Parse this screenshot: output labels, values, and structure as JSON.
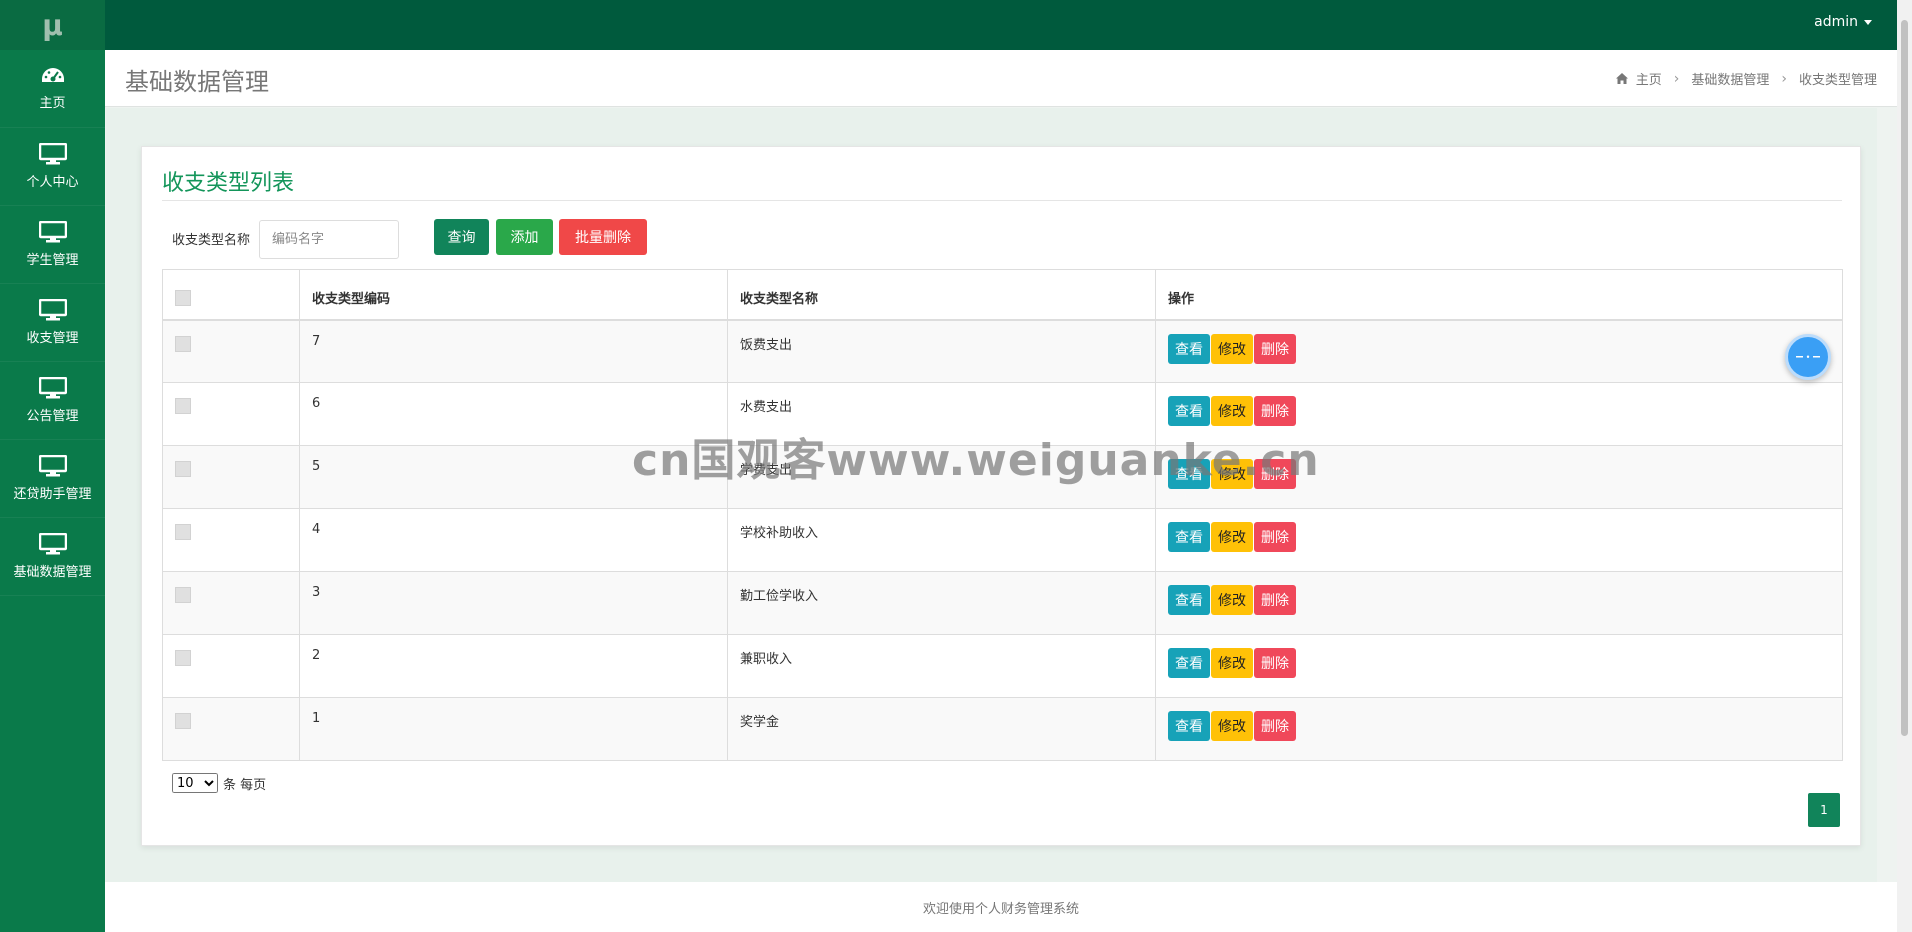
{
  "app": {
    "logo": "μ"
  },
  "topbar": {
    "user": "admin"
  },
  "sidebar": {
    "items": [
      {
        "label": "主页",
        "icon": "dashboard-icon"
      },
      {
        "label": "个人中心",
        "icon": "monitor-icon"
      },
      {
        "label": "学生管理",
        "icon": "monitor-icon"
      },
      {
        "label": "收支管理",
        "icon": "monitor-icon"
      },
      {
        "label": "公告管理",
        "icon": "monitor-icon"
      },
      {
        "label": "还贷助手管理",
        "icon": "monitor-icon"
      },
      {
        "label": "基础数据管理",
        "icon": "monitor-icon"
      }
    ]
  },
  "page": {
    "title": "基础数据管理",
    "breadcrumb": {
      "home": "主页",
      "section": "基础数据管理",
      "current": "收支类型管理"
    }
  },
  "card": {
    "title": "收支类型列表",
    "search": {
      "label": "收支类型名称",
      "placeholder": "编码名字"
    },
    "buttons": {
      "query": "查询",
      "add": "添加",
      "batch_delete": "批量删除"
    }
  },
  "table": {
    "headers": {
      "code": "收支类型编码",
      "name": "收支类型名称",
      "ops": "操作"
    },
    "op_labels": {
      "view": "查看",
      "edit": "修改",
      "delete": "删除"
    },
    "rows": [
      {
        "code": "7",
        "name": "饭费支出"
      },
      {
        "code": "6",
        "name": "水费支出"
      },
      {
        "code": "5",
        "name": "学费支出"
      },
      {
        "code": "4",
        "name": "学校补助收入"
      },
      {
        "code": "3",
        "name": "勤工俭学收入"
      },
      {
        "code": "2",
        "name": "兼职收入"
      },
      {
        "code": "1",
        "name": "奖学金"
      }
    ]
  },
  "pager": {
    "page_size": "10",
    "size_suffix": "条 每页",
    "current_page": "1"
  },
  "footer": {
    "text": "欢迎使用个人财务管理系统"
  },
  "watermark": "cn国观客www.weiguanke.cn",
  "colors": {
    "sidebar": "#0a7a4a",
    "topbar": "#005a3d",
    "accent": "#13955a"
  }
}
